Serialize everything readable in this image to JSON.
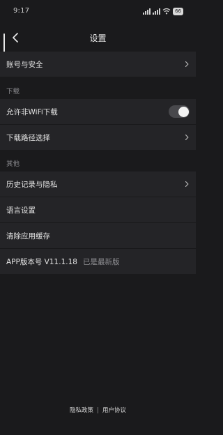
{
  "status_bar": {
    "time": "9:17",
    "battery": "66"
  },
  "header": {
    "title": "设置"
  },
  "rows": {
    "account_security": "账号与安全",
    "allow_non_wifi_download": "允许非WiFi下载",
    "download_path": "下载路径选择",
    "history_privacy": "历史记录与隐私",
    "language": "语言设置",
    "clear_cache": "清除应用缓存",
    "app_version_label": "APP版本号 V11.1.18",
    "app_version_status": "已是最新版"
  },
  "sections": {
    "download": "下载",
    "other": "其他"
  },
  "toggles": {
    "allow_non_wifi_download_on": false
  },
  "footer": {
    "privacy_policy": "隐私政策",
    "separator": "|",
    "user_agreement": "用户协议"
  },
  "icons": {
    "back": "chevron-left-icon",
    "row_arrow": "chevron-right-icon"
  },
  "colors": {
    "background": "#1a1a1c",
    "row_background": "#242427",
    "section_text": "#8b8b8f",
    "toggle_track_off": "#48484c"
  }
}
